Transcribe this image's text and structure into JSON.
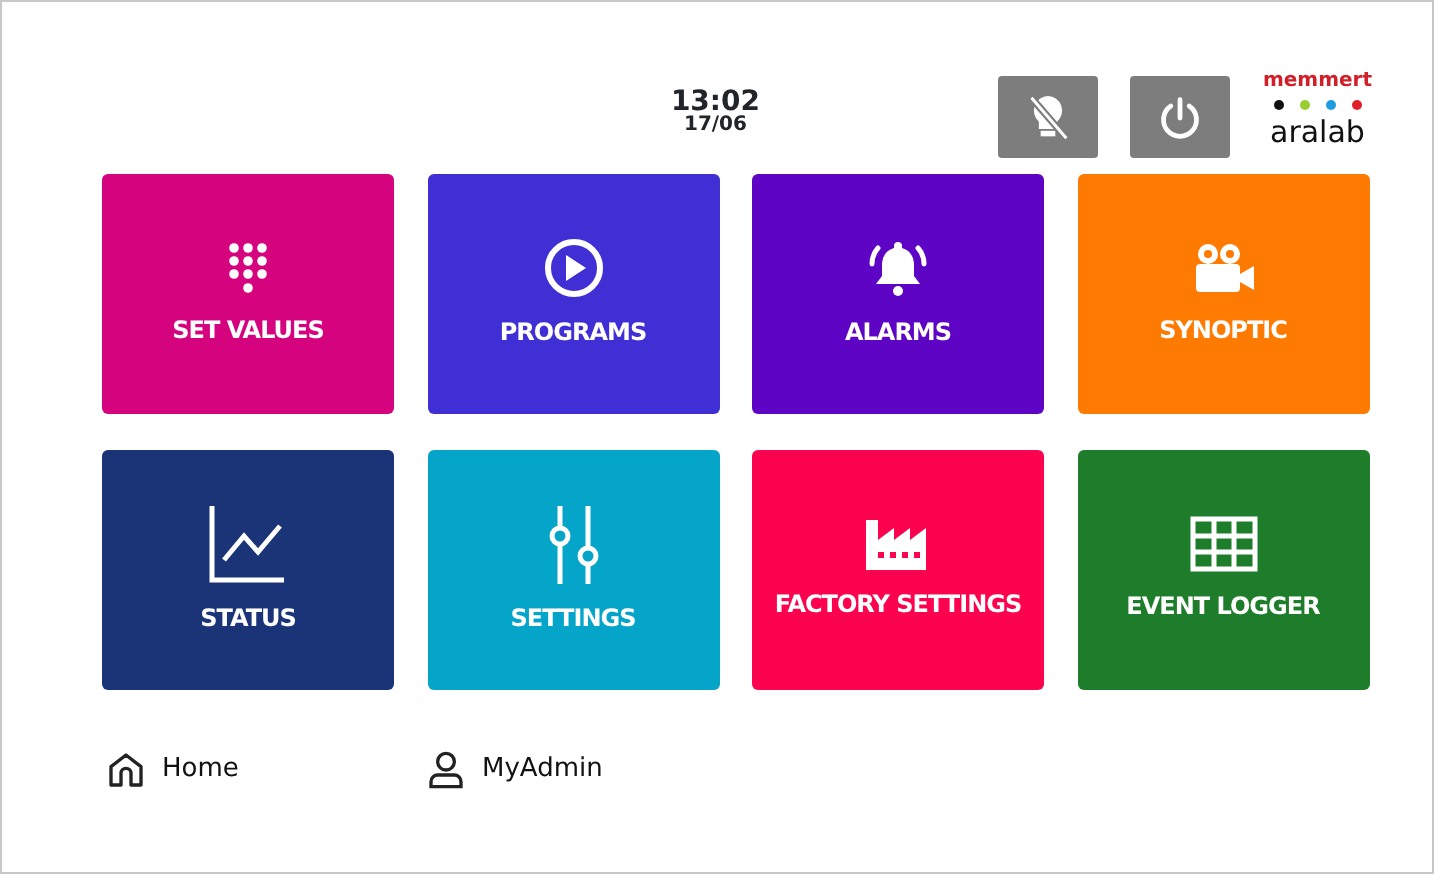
{
  "header": {
    "time": "13:02",
    "date": "17/06",
    "buttons": [
      {
        "kind": "light-off"
      },
      {
        "kind": "power"
      }
    ],
    "logo": {
      "top": "memmert",
      "bottom": "aralab",
      "dots": [
        {
          "color": "#111111"
        },
        {
          "color": "#9acd32"
        },
        {
          "color": "#1e9be0"
        },
        {
          "color": "#e0202a"
        }
      ]
    }
  },
  "tiles": [
    {
      "label": "SET VALUES",
      "kind": "keypad",
      "color": "#d6037f"
    },
    {
      "label": "PROGRAMS",
      "kind": "play",
      "color": "#3f2fd4"
    },
    {
      "label": "ALARMS",
      "kind": "bell",
      "color": "#5e04c4"
    },
    {
      "label": "SYNOPTIC",
      "kind": "camera",
      "color": "#ff7a00"
    },
    {
      "label": "STATUS",
      "kind": "chart",
      "color": "#1b3478"
    },
    {
      "label": "SETTINGS",
      "kind": "sliders",
      "color": "#04a5c8"
    },
    {
      "label": "FACTORY SETTINGS",
      "kind": "factory",
      "color": "#fc0350"
    },
    {
      "label": "EVENT LOGGER",
      "kind": "grid",
      "color": "#1d7d2a"
    }
  ],
  "footer": [
    {
      "label": "Home",
      "kind": "home"
    },
    {
      "label": "MyAdmin",
      "kind": "user"
    }
  ]
}
